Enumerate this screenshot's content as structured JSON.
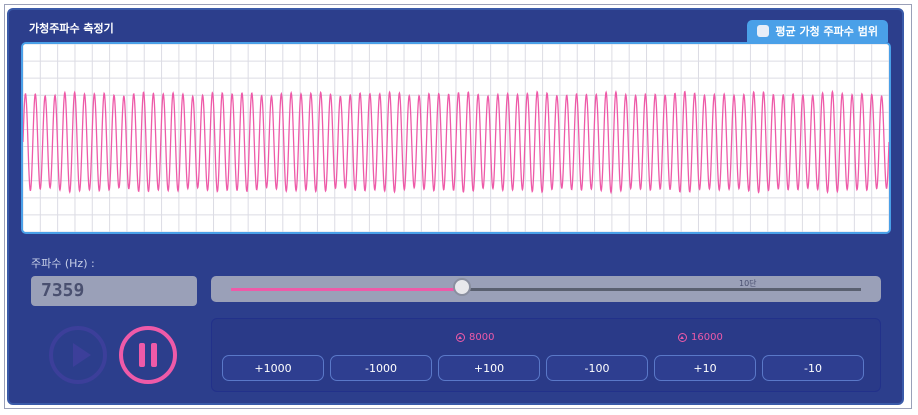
{
  "app": {
    "title": "가청주파수 측정기"
  },
  "avg_toggle": {
    "label": "평균 가청 주파수 범위",
    "checked": false
  },
  "frequency": {
    "label": "주파수 (Hz) :",
    "value": "7359"
  },
  "slider": {
    "min": 20,
    "max": 20000,
    "value": 7359,
    "tick_label": "10단"
  },
  "markers": [
    {
      "label": "8000"
    },
    {
      "label": "16000"
    }
  ],
  "steps": [
    {
      "label": "+1000"
    },
    {
      "label": "-1000"
    },
    {
      "label": "+100"
    },
    {
      "label": "-100"
    },
    {
      "label": "+10"
    },
    {
      "label": "-10"
    }
  ],
  "colors": {
    "panel": "#2c3e8c",
    "accent": "#ee5aa8",
    "scope_border": "#4aa0e8",
    "wave": "#ee5aa8"
  },
  "icons": {
    "play": "play-icon",
    "pause": "pause-icon",
    "marker": "up-arrow-circle-icon"
  }
}
